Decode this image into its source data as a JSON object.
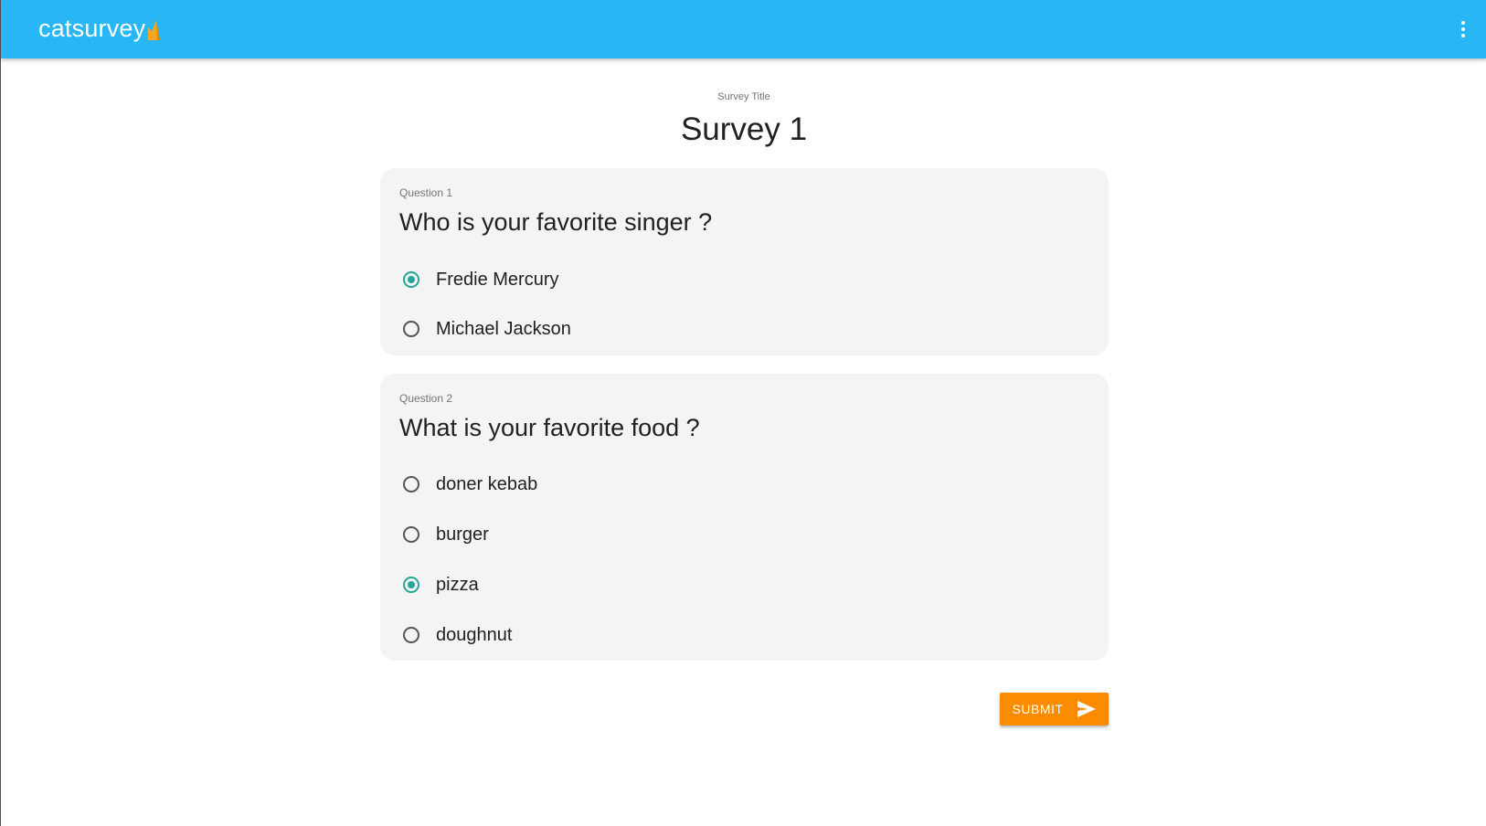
{
  "app": {
    "brand": "catsurvey",
    "brand_mark_icon": "cat-ear-icon",
    "menu_icon": "more-vert-icon"
  },
  "colors": {
    "appbar": "#29b6f6",
    "accent_radio": "#26a69a",
    "submit": "#fb8c00",
    "card": "#f4f4f4"
  },
  "survey": {
    "caption": "Survey Title",
    "title": "Survey 1",
    "questions": [
      {
        "label": "Question 1",
        "text": "Who is your favorite singer ?",
        "options": [
          {
            "label": "Fredie Mercury",
            "checked": true
          },
          {
            "label": "Michael Jackson",
            "checked": false
          }
        ]
      },
      {
        "label": "Question 2",
        "text": "What is your favorite food ?",
        "options": [
          {
            "label": "doner kebab",
            "checked": false
          },
          {
            "label": "burger",
            "checked": false
          },
          {
            "label": "pizza",
            "checked": true
          },
          {
            "label": "doughnut",
            "checked": false
          }
        ]
      }
    ]
  },
  "actions": {
    "submit_label": "SUBMIT",
    "submit_icon": "send-icon"
  }
}
